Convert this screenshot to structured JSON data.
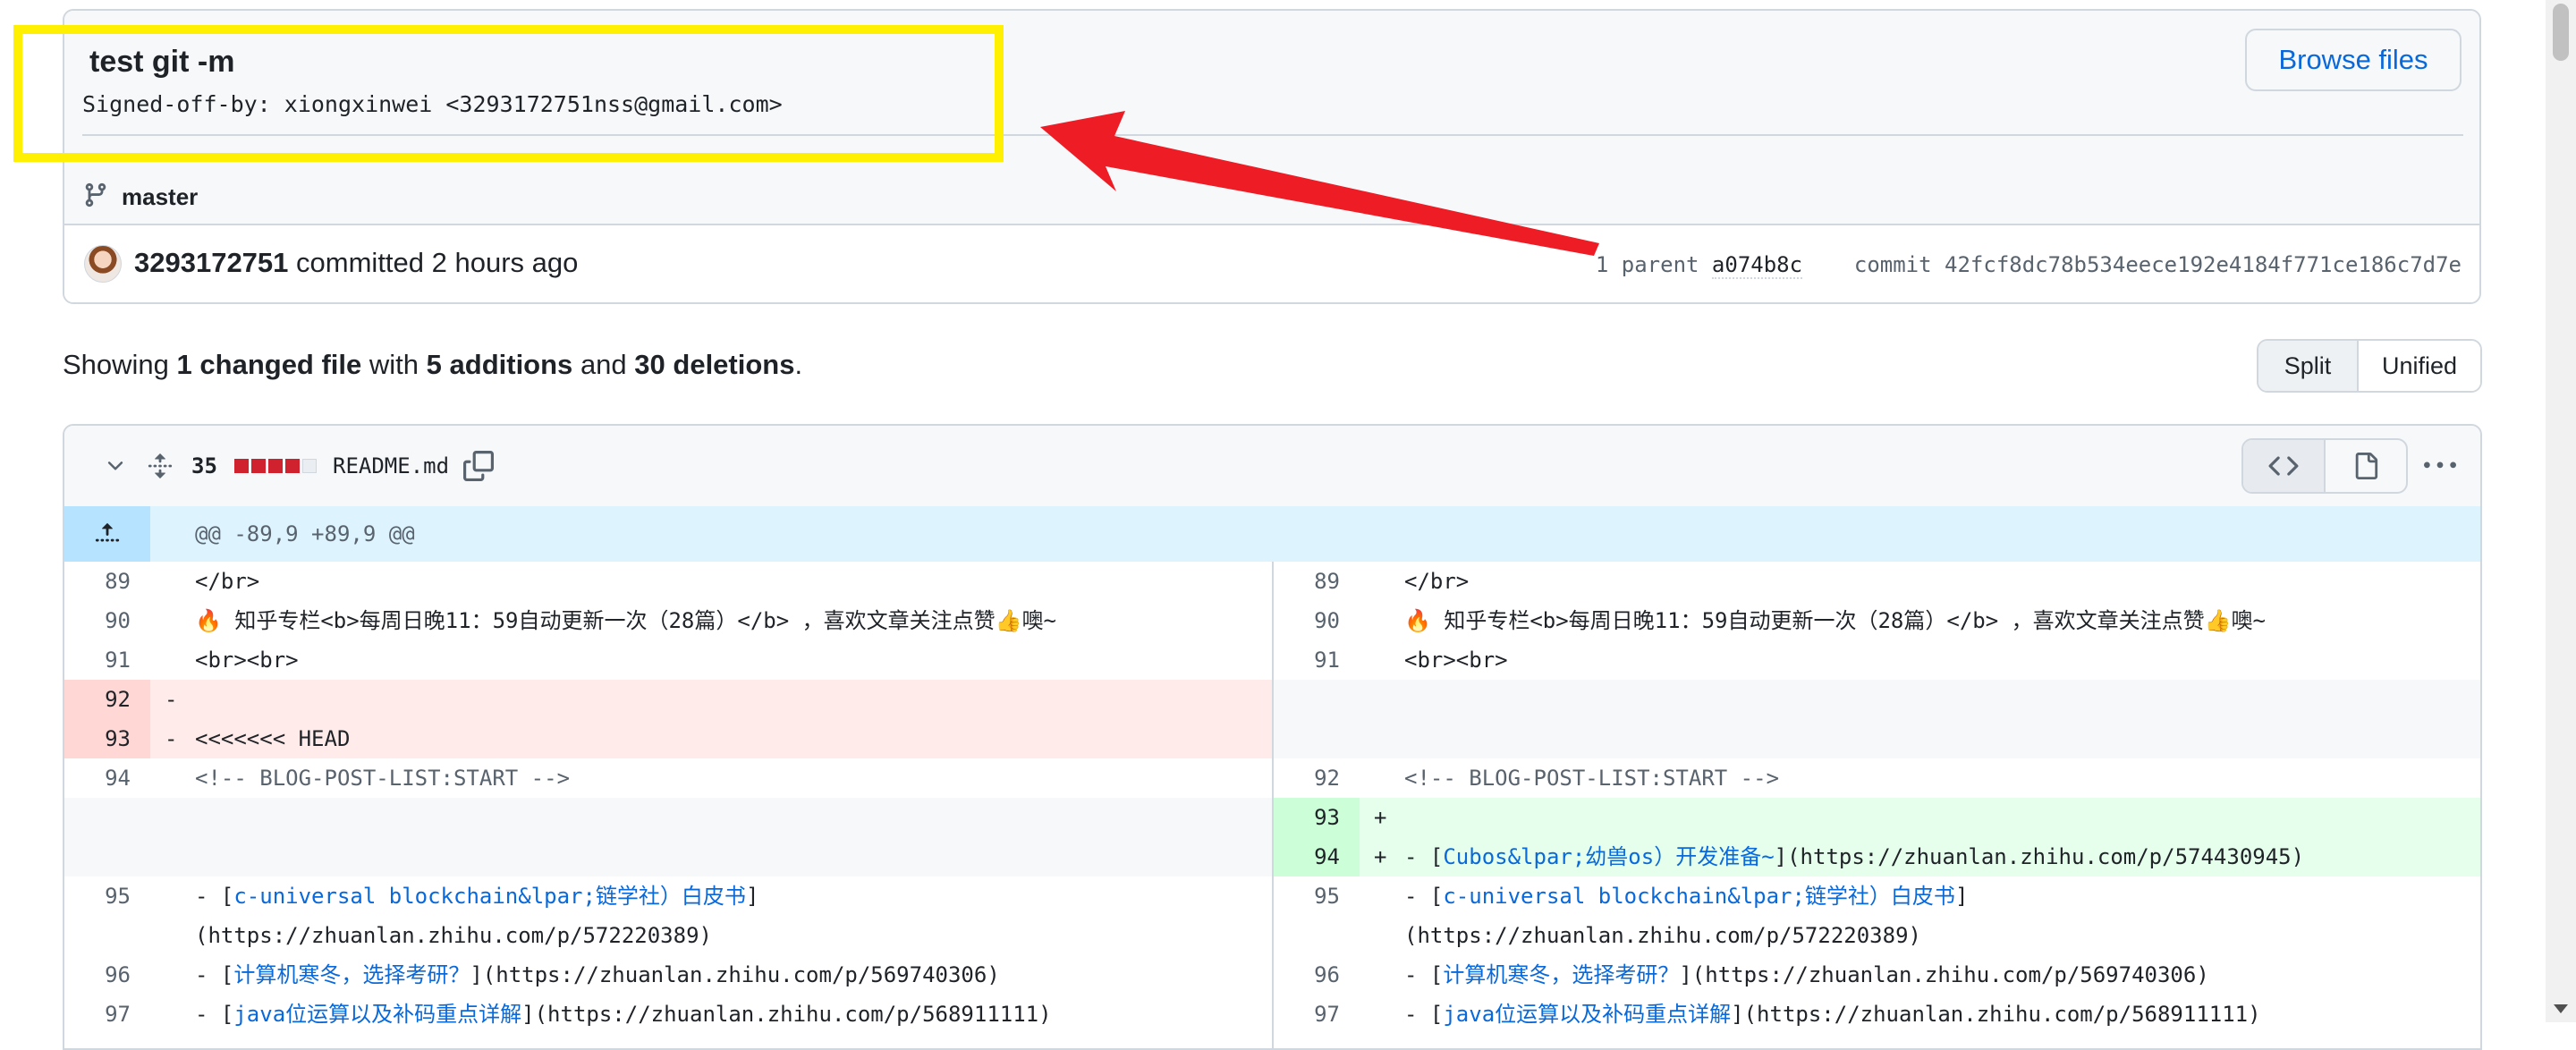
{
  "commit": {
    "title": "test git -m",
    "body": "Signed-off-by: xiongxinwei <3293172751nss@gmail.com>",
    "browse_label": "Browse files",
    "branch": "master",
    "author": "3293172751",
    "committed_text": "committed 2 hours ago",
    "parent_label": "1 parent",
    "parent_sha": "a074b8c",
    "commit_label": "commit",
    "commit_sha": "42fcf8dc78b534eece192e4184f771ce186c7d7e"
  },
  "summary": {
    "showing": "Showing",
    "changed": "1 changed file",
    "with": "with",
    "additions": "5 additions",
    "and": "and",
    "deletions": "30 deletions",
    "period": "."
  },
  "view_toggle": {
    "split": "Split",
    "unified": "Unified",
    "selected": "Split"
  },
  "file": {
    "changes": "35",
    "name": "README.md",
    "diffstat": [
      "del",
      "del",
      "del",
      "del",
      "neutral"
    ],
    "hunk": "@@ -89,9 +89,9 @@"
  },
  "left_rows": [
    {
      "num": "89",
      "type": "ctx",
      "sign": "",
      "code": "</br>"
    },
    {
      "num": "90",
      "type": "ctx",
      "sign": "",
      "code": "🔥 知乎专栏<b>每周日晚11：59自动更新一次（28篇）</b> ，喜欢文章关注点赞👍噢~"
    },
    {
      "num": "91",
      "type": "ctx",
      "sign": "",
      "code": "<br><br>"
    },
    {
      "num": "92",
      "type": "del",
      "sign": "-",
      "code": ""
    },
    {
      "num": "93",
      "type": "del",
      "sign": "-",
      "code": "<<<<<<< HEAD"
    },
    {
      "num": "94",
      "type": "ctx",
      "sign": "",
      "code": "<!-- BLOG-POST-LIST:START -->"
    },
    {
      "num": "",
      "type": "empty",
      "sign": "",
      "code": ""
    },
    {
      "num": "",
      "type": "empty",
      "sign": "",
      "code": ""
    },
    {
      "num": "95",
      "type": "ctx",
      "sign": "",
      "pre": "- [",
      "link": "c-universal blockchain&lpar;链学社）白皮书",
      "post": "]\n(https://zhuanlan.zhihu.com/p/572220389)"
    },
    {
      "num": "96",
      "type": "ctx",
      "sign": "",
      "pre": "- [",
      "link": "计算机寒冬，选择考研？",
      "post": "](https://zhuanlan.zhihu.com/p/569740306)"
    },
    {
      "num": "97",
      "type": "ctx",
      "sign": "",
      "pre": "- [",
      "link": "java位运算以及补码重点详解",
      "post": "](https://zhuanlan.zhihu.com/p/568911111)"
    }
  ],
  "right_rows": [
    {
      "num": "89",
      "type": "ctx",
      "sign": "",
      "code": "</br>"
    },
    {
      "num": "90",
      "type": "ctx",
      "sign": "",
      "code": "🔥 知乎专栏<b>每周日晚11：59自动更新一次（28篇）</b> ，喜欢文章关注点赞👍噢~"
    },
    {
      "num": "91",
      "type": "ctx",
      "sign": "",
      "code": "<br><br>"
    },
    {
      "num": "",
      "type": "empty",
      "sign": "",
      "code": ""
    },
    {
      "num": "",
      "type": "empty",
      "sign": "",
      "code": ""
    },
    {
      "num": "92",
      "type": "ctx",
      "sign": "",
      "code": "<!-- BLOG-POST-LIST:START -->"
    },
    {
      "num": "93",
      "type": "add",
      "sign": "+",
      "code": ""
    },
    {
      "num": "94",
      "type": "add",
      "sign": "+",
      "pre": "- [",
      "link": "Cubos&lpar;幼兽os）开发准备~",
      "post": "](https://zhuanlan.zhihu.com/p/574430945)"
    },
    {
      "num": "95",
      "type": "ctx",
      "sign": "",
      "pre": "- [",
      "link": "c-universal blockchain&lpar;链学社）白皮书",
      "post": "]\n(https://zhuanlan.zhihu.com/p/572220389)"
    },
    {
      "num": "96",
      "type": "ctx",
      "sign": "",
      "pre": "- [",
      "link": "计算机寒冬，选择考研？",
      "post": "](https://zhuanlan.zhihu.com/p/569740306)"
    },
    {
      "num": "97",
      "type": "ctx",
      "sign": "",
      "pre": "- [",
      "link": "java位运算以及补码重点详解",
      "post": "](https://zhuanlan.zhihu.com/p/568911111)"
    }
  ],
  "colors": {
    "annotation_box": "#ffef00",
    "annotation_arrow": "#ee1c25",
    "link": "#0969da",
    "deletion_bg": "#ffebe9",
    "addition_bg": "#e6ffec",
    "hunk_bg": "#ddf4ff"
  },
  "icons": {
    "branch": "git-branch-icon",
    "collapse": "chevron-down-icon",
    "expand": "unfold-icon",
    "copy": "copy-icon",
    "code_view": "code-icon",
    "file_view": "file-icon",
    "more": "kebab-horizontal-icon",
    "expand_up": "fold-up-icon"
  }
}
